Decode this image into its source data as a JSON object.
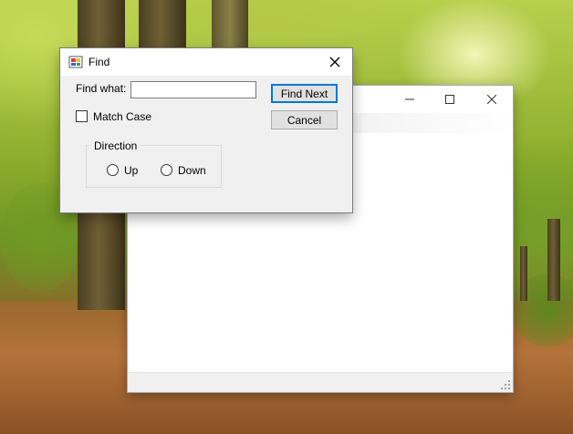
{
  "dialog": {
    "title": "Find",
    "icon": "app-form-icon",
    "find_label": "Find what:",
    "find_value": "",
    "find_next_label": "Find Next",
    "cancel_label": "Cancel",
    "match_case_label": "Match Case",
    "match_case_checked": false,
    "direction_label": "Direction",
    "up_label": "Up",
    "down_label": "Down",
    "direction_selected": "none"
  },
  "main_window": {
    "title": "",
    "caption_buttons": [
      "minimize-icon",
      "maximize-icon",
      "close-icon"
    ]
  },
  "colors": {
    "accent": "#0078d7",
    "dialog_bg": "#f0f0f0"
  }
}
